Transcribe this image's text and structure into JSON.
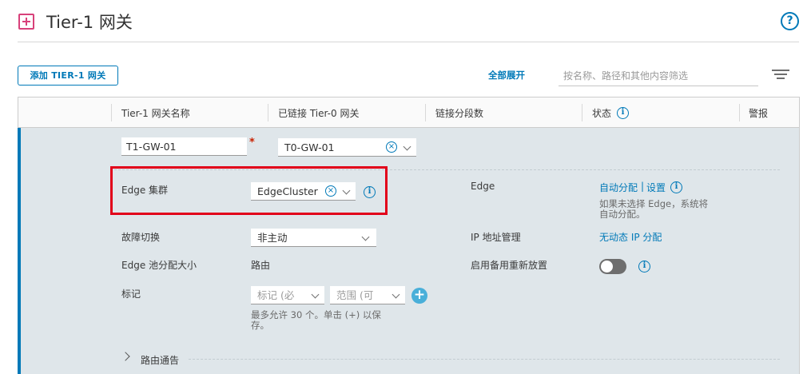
{
  "header": {
    "title": "Tier-1 网关",
    "icon": "router-icon",
    "help_icon": "help-icon",
    "help_glyph": "?"
  },
  "toolbar": {
    "add_button": "添加 TIER-1 网关",
    "expand_all": "全部展开",
    "filter_placeholder": "按名称、路径和其他内容筛选",
    "filter_icon": "filter-icon"
  },
  "table": {
    "columns": [
      "Tier-1 网关名称",
      "已链接 Tier-0 网关",
      "链接分段数",
      "状态",
      "警报"
    ],
    "status_info_glyph": "i"
  },
  "form": {
    "name_value": "T1-GW-01",
    "required_mark": "*",
    "tier0_value": "T0-GW-01",
    "edge_cluster_label": "Edge 集群",
    "edge_cluster_value": "EdgeCluster",
    "edge_label": "Edge",
    "edge_links": {
      "auto": "自动分配",
      "sep": "|",
      "settings": "设置"
    },
    "edge_helper_line1": "如果未选择 Edge，系统将",
    "edge_helper_line2": "自动分配。",
    "failover_label": "故障切换",
    "failover_value": "非主动",
    "ip_mgmt_label": "IP 地址管理",
    "ip_mgmt_value": "无动态 IP 分配",
    "pool_label": "Edge 池分配大小",
    "pool_value": "路由",
    "standby_label": "启用备用重新放置",
    "standby_enabled": false,
    "tags_label": "标记",
    "tag_placeholder": "标记 (必",
    "scope_placeholder": "范围 (可",
    "add_glyph": "+",
    "tags_helper_line1": "最多允许 30 个。单击 (+) 以保",
    "tags_helper_line2": "存。",
    "route_adv_label": "路由通告",
    "clear_glyph": "×",
    "info_glyph": "i"
  },
  "colors": {
    "accent": "#0079b8",
    "highlight_box": "#e2001a",
    "row_bg": "#dfe6ea"
  }
}
